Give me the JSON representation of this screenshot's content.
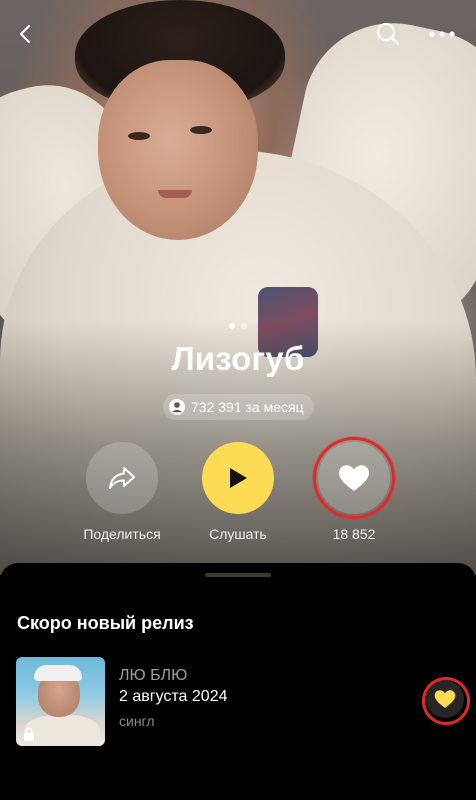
{
  "header": {
    "back_icon": "chevron-left-icon",
    "search_icon": "search-icon",
    "more_icon": "more-horizontal-icon"
  },
  "artist": {
    "name": "Лизогуб",
    "monthly_listeners": "732 391 за месяц",
    "page_dots": 2,
    "active_dot": 0
  },
  "actions": {
    "share_label": "Поделиться",
    "listen_label": "Слушать",
    "likes_count": "18 852"
  },
  "upcoming": {
    "section_title": "Скоро новый релиз",
    "release": {
      "title": "ЛЮ БЛЮ",
      "date": "2 августа 2024",
      "type": "сингл"
    }
  },
  "colors": {
    "accent_yellow": "#fedb55",
    "highlight_red": "#e02a2a",
    "background": "#000000"
  }
}
